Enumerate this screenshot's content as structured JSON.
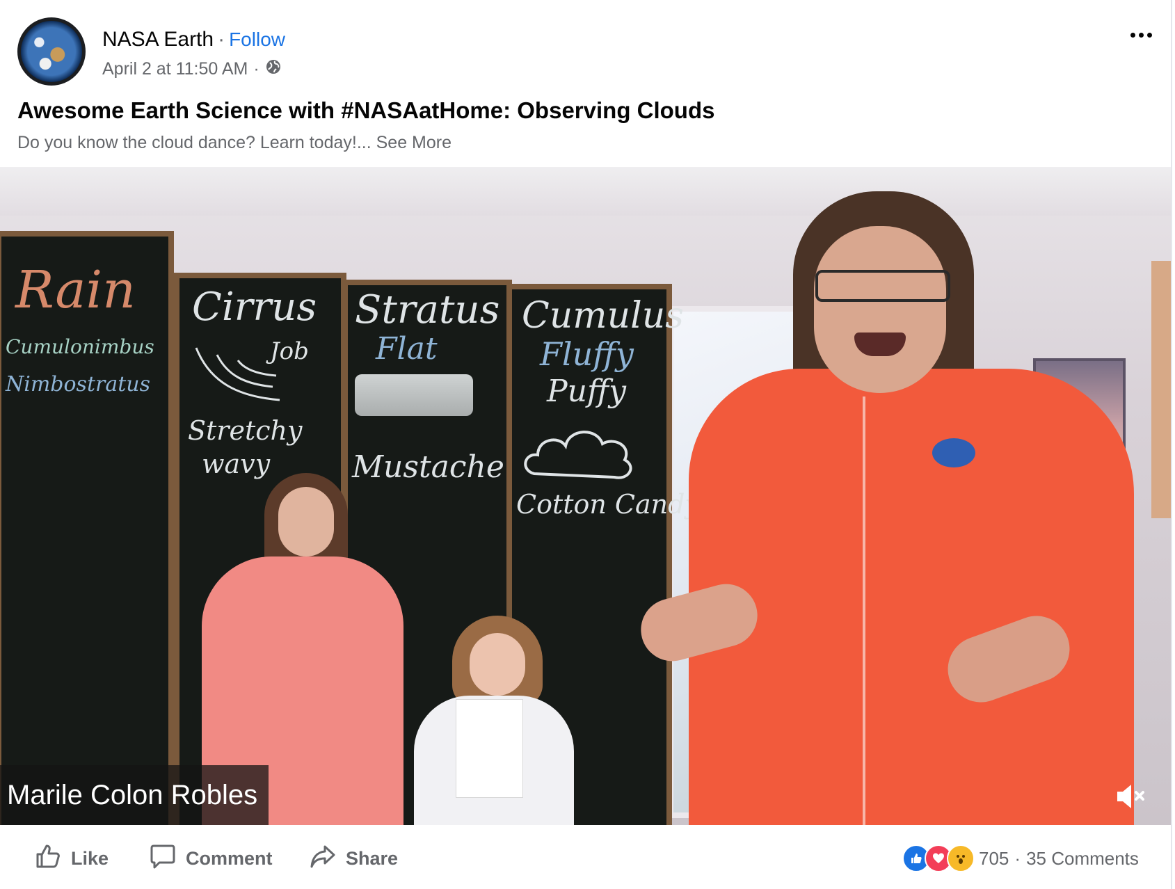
{
  "post": {
    "page_name": "NASA Earth",
    "follow_label": "Follow",
    "separator": "·",
    "timestamp": "April 2 at 11:50 AM",
    "audience_icon": "globe-icon",
    "title": "Awesome Earth Science with #NASAatHome: Observing Clouds",
    "description": "Do you know the cloud dance? Learn today!...",
    "see_more_label": "See More"
  },
  "video": {
    "speaker_name": "Marile Colon Robles",
    "muted": true,
    "mute_icon": "speaker-muted-icon",
    "chalkboard": {
      "panel1": [
        "Rain",
        "Cumulonimbus",
        "Nimbostratus"
      ],
      "panel2": [
        "Cirrus",
        "Job",
        "Stretchy",
        "wavy"
      ],
      "panel3": [
        "Stratus",
        "Flat",
        "Mustache"
      ],
      "panel4": [
        "Cumulus",
        "Fluffy",
        "Puffy",
        "Cotton Candy"
      ]
    }
  },
  "actions": {
    "like_label": "Like",
    "comment_label": "Comment",
    "share_label": "Share"
  },
  "engagement": {
    "reaction_count": "705",
    "comments_count": "35 Comments",
    "reaction_icons": [
      "like-reaction-icon",
      "love-reaction-icon",
      "wow-reaction-icon"
    ]
  },
  "colors": {
    "accent": "#1b74e4",
    "text_primary": "#050505",
    "text_secondary": "#65676b"
  }
}
